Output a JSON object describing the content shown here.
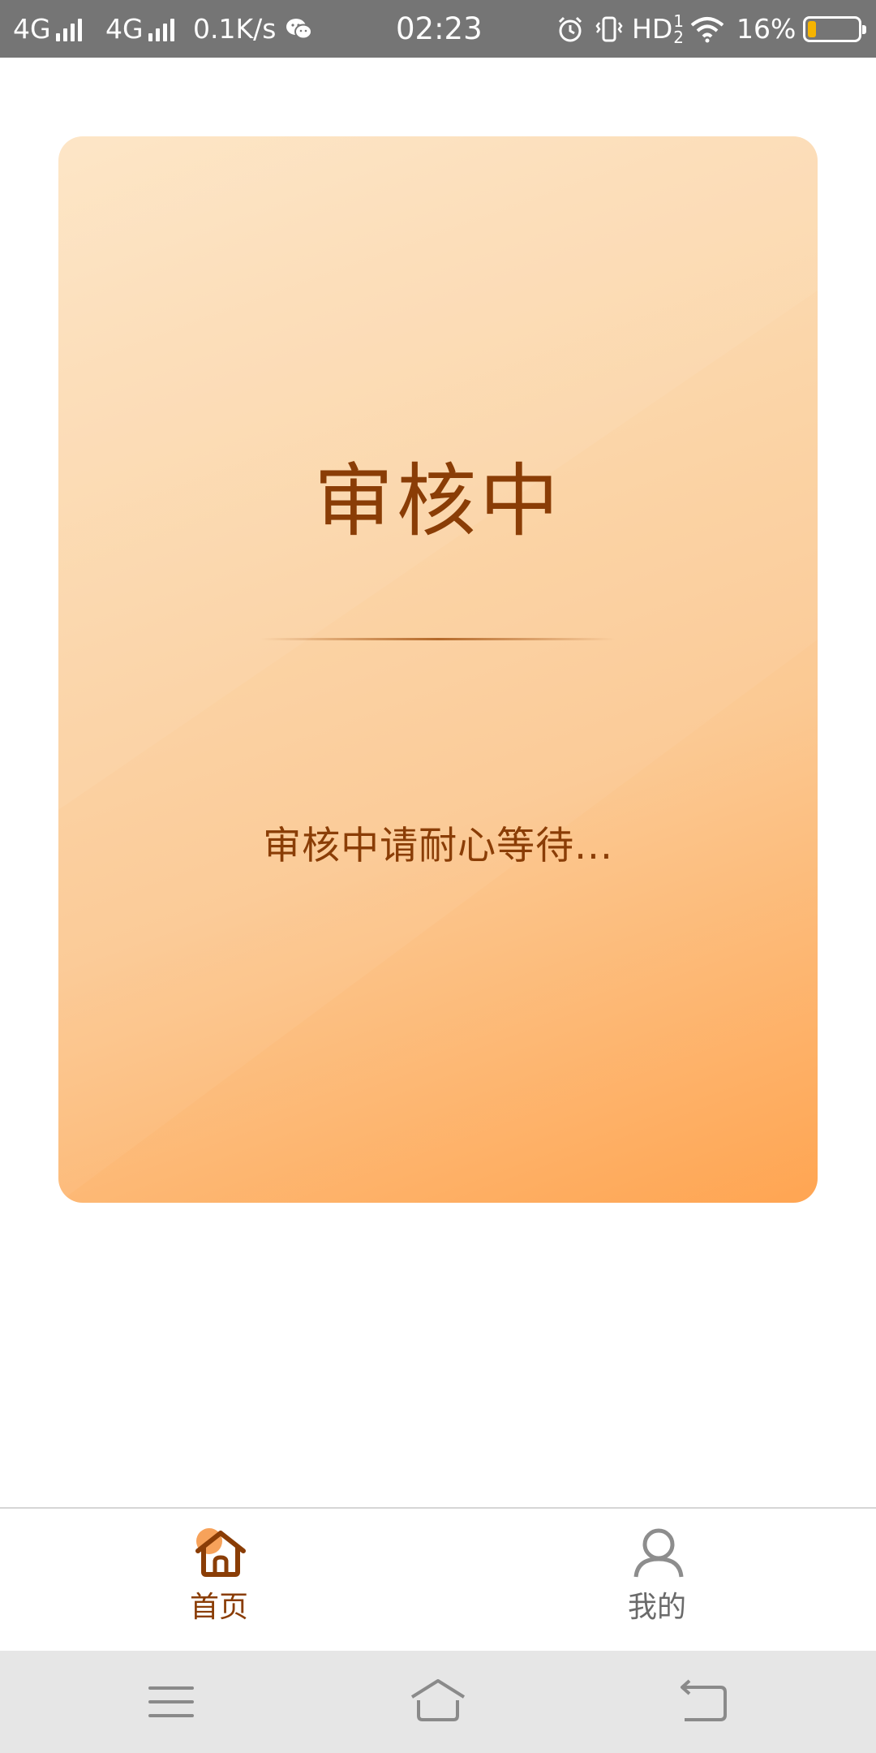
{
  "status_bar": {
    "network_1": "4G",
    "network_2": "4G",
    "speed": "0.1K/s",
    "time": "02:23",
    "hd_label": "HD",
    "hd_sup": "1",
    "hd_sub": "2",
    "battery_text": "16%",
    "battery_level": 0.16,
    "icons": [
      "signal-icon",
      "wechat-icon",
      "alarm-icon",
      "vibrate-icon",
      "wifi-icon",
      "battery-icon"
    ]
  },
  "card": {
    "title": "审核中",
    "message": "审核中请耐心等待..."
  },
  "tabs": [
    {
      "label": "首页",
      "icon": "home-icon",
      "active": true
    },
    {
      "label": "我的",
      "icon": "user-icon",
      "active": false
    }
  ],
  "nav_bar": {
    "icons": [
      "menu-icon",
      "home-outline-icon",
      "back-icon"
    ]
  },
  "colors": {
    "status_bar_bg": "#757575",
    "accent_text": "#8a3d06",
    "card_gradient_start": "#fde3c1",
    "card_gradient_end": "#ffa552",
    "nav_bar_bg": "#e6e6e6",
    "inactive_tab": "#6a6a6a"
  }
}
